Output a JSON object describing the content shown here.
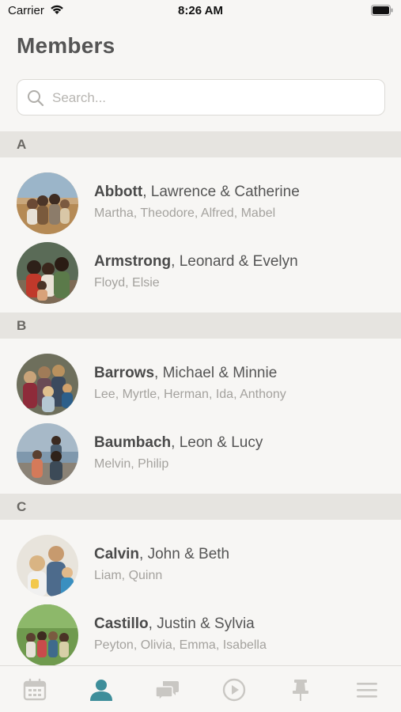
{
  "status": {
    "carrier": "Carrier",
    "time": "8:26 AM"
  },
  "page": {
    "title": "Members"
  },
  "search": {
    "placeholder": "Search..."
  },
  "sections": [
    {
      "letter": "A",
      "members": [
        {
          "surname": "Abbott",
          "parents": "Lawrence & Catherine",
          "children": "Martha, Theodore, Alfred, Mabel"
        },
        {
          "surname": "Armstrong",
          "parents": "Leonard & Evelyn",
          "children": "Floyd, Elsie"
        }
      ]
    },
    {
      "letter": "B",
      "members": [
        {
          "surname": "Barrows",
          "parents": "Michael & Minnie",
          "children": "Lee, Myrtle, Herman, Ida, Anthony"
        },
        {
          "surname": "Baumbach",
          "parents": "Leon & Lucy",
          "children": "Melvin, Philip"
        }
      ]
    },
    {
      "letter": "C",
      "members": [
        {
          "surname": "Calvin",
          "parents": "John & Beth",
          "children": "Liam, Quinn"
        },
        {
          "surname": "Castillo",
          "parents": "Justin & Sylvia",
          "children": "Peyton, Olivia, Emma, Isabella"
        }
      ]
    }
  ],
  "tabs": [
    {
      "icon": "calendar-icon",
      "active": false
    },
    {
      "icon": "person-icon",
      "active": true
    },
    {
      "icon": "chat-bubbles-icon",
      "active": false
    },
    {
      "icon": "play-icon",
      "active": false
    },
    {
      "icon": "pin-icon",
      "active": false
    },
    {
      "icon": "menu-icon",
      "active": false
    }
  ],
  "colors": {
    "accent": "#3e8e9a",
    "inactive_tab": "#c9c7c3",
    "background": "#f7f6f4",
    "section": "#e6e4e0"
  }
}
